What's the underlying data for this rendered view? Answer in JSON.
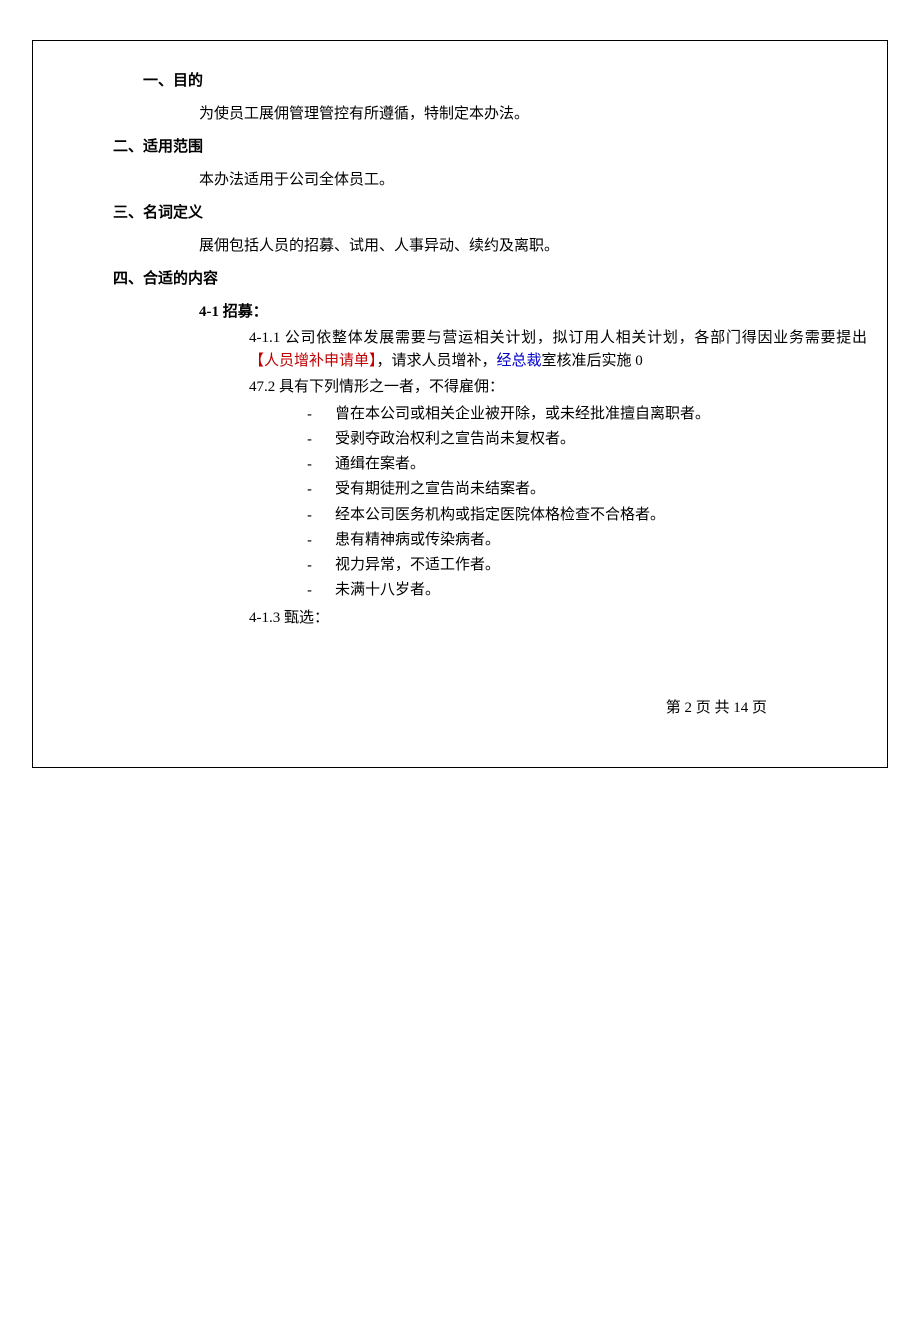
{
  "section1": {
    "heading": "一、目的",
    "body": "为使员工展佣管理管控有所遵循，特制定本办法。"
  },
  "section2": {
    "heading": "二、适用范围",
    "body": "本办法适用于公司全体员工。"
  },
  "section3": {
    "heading": "三、名词定义",
    "body": "展佣包括人员的招募、试用、人事异动、续约及离职。"
  },
  "section4": {
    "heading": "四、合适的内容",
    "sub1_label": "4-1 招募：",
    "item1_prefix": "4-1.1 公司依整体发展需要与营运相关计划，拟订用人相关计划，各部门得因业务需要提出",
    "item1_red": "【人员增补申请单】",
    "item1_mid1": "，请求人员增补，",
    "item1_blue": "经总裁",
    "item1_tail": "室核准后实施 0",
    "item2_label": "47.2 具有下列情形之一者，不得雇佣：",
    "bullets": [
      "曾在本公司或相关企业被开除，或未经批准擅自离职者。",
      "受剥夺政治权利之宣告尚未复权者。",
      "通缉在案者。",
      "受有期徒刑之宣告尚未结案者。",
      "经本公司医务机构或指定医院体格检查不合格者。",
      "患有精神病或传染病者。",
      "视力异常，不适工作者。",
      "未满十八岁者。"
    ],
    "item3_label": "4-1.3 甄选："
  },
  "footer": "第 2 页 共 14 页"
}
